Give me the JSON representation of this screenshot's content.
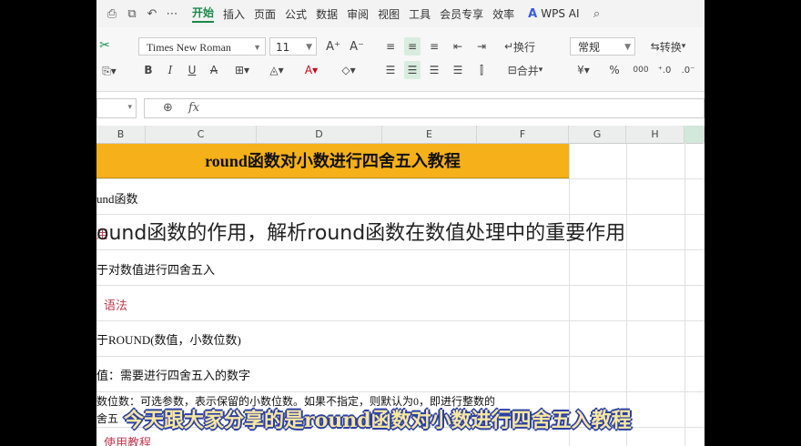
{
  "menu": {
    "quick_icons": [
      "print-icon",
      "print-preview-icon",
      "undo-icon",
      "more-icon"
    ],
    "items": [
      "开始",
      "插入",
      "页面",
      "公式",
      "数据",
      "审阅",
      "视图",
      "工具",
      "会员专享",
      "效率"
    ],
    "wps_ai": "WPS AI"
  },
  "ribbon": {
    "font_name": "Times New Roman",
    "font_size": "11",
    "wrap_label": "换行",
    "merge_label": "合并",
    "number_format": "常规",
    "convert_label": "转换",
    "pct": "%",
    "thousands": "000"
  },
  "formula_bar": {
    "fx": "fx"
  },
  "columns": [
    "B",
    "C",
    "D",
    "E",
    "F",
    "G",
    "H"
  ],
  "sheet": {
    "title": "round函数对小数进行四舍五入教程",
    "rows": [
      {
        "text": "und函数",
        "style": "normal"
      },
      {
        "text": "用",
        "style": "red"
      },
      {
        "text": "于对数值进行四舍五入",
        "style": "normal"
      },
      {
        "text": "语法",
        "style": "red"
      },
      {
        "text": "于ROUND(数值，小数位数)",
        "style": "normal"
      },
      {
        "text": "值：需要进行四舍五入的数字",
        "style": "normal"
      },
      {
        "text": "数位数：可选参数，表示保留的小数位数。如果不指定，则默认为0，即进行整数的",
        "style": "normal"
      },
      {
        "text": "舍五",
        "style": "normal"
      },
      {
        "text": "使用教程",
        "style": "red"
      }
    ]
  },
  "overlay": {
    "caption_title": "ound函数的作用，解析round函数在数值处理中的重要作用",
    "subtitle": "今天跟大家分享的是round函数对小数进行四舍五入教程"
  },
  "colors": {
    "title_bg": "#f6b019",
    "accent": "#1a8a4a",
    "subtitle_outline": "#2b3fa5"
  }
}
